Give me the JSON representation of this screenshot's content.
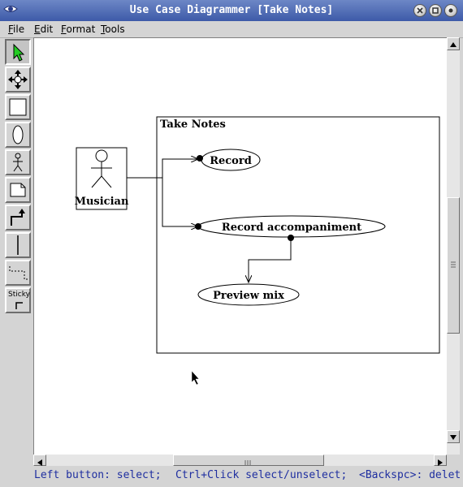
{
  "window": {
    "title": "Use Case Diagrammer [Take Notes]"
  },
  "menu": [
    "File",
    "Edit",
    "Format",
    "Tools"
  ],
  "toolbar": {
    "tools": [
      "select-tool",
      "move-tool",
      "box-tool",
      "use-case-tool",
      "actor-tool",
      "note-tool",
      "connector-tool",
      "line-tool",
      "dotted-connector-tool",
      "sticky-tool"
    ],
    "sticky_label": "Sticky"
  },
  "diagram": {
    "system_label": "Take Notes",
    "actor": "Musician",
    "use_cases": [
      "Record",
      "Record accompaniment",
      "Preview mix"
    ]
  },
  "status": {
    "hints": [
      "Left button: select;",
      "Ctrl+Click select/unselect;",
      "<Backspc>: delet"
    ]
  }
}
